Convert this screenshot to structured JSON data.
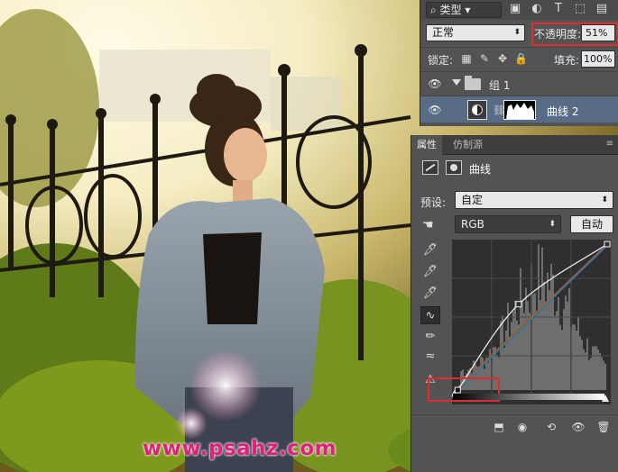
{
  "watermark": "www.psahz.com",
  "layers_panel": {
    "filter_kind": "类型",
    "blend_mode": "正常",
    "opacity_label": "不透明度:",
    "opacity_value": "51%",
    "lock_label": "锁定:",
    "fill_label": "填充:",
    "fill_value": "100%",
    "group_name": "组 1",
    "layer_name": "曲线 2"
  },
  "properties_panel": {
    "tabs": [
      "属性",
      "仿制源"
    ],
    "title": "曲线",
    "preset_label": "预设:",
    "preset_value": "自定",
    "channel_value": "RGB",
    "auto_button": "自动"
  },
  "curves": {
    "input_range": [
      0,
      255
    ],
    "output_range": [
      0,
      255
    ],
    "rgb_points": [
      [
        0,
        0
      ],
      [
        5,
        0
      ],
      [
        107,
        150
      ],
      [
        255,
        255
      ]
    ],
    "highlight_color": "#e22b2b",
    "selected_layer_color": "#586d85"
  }
}
